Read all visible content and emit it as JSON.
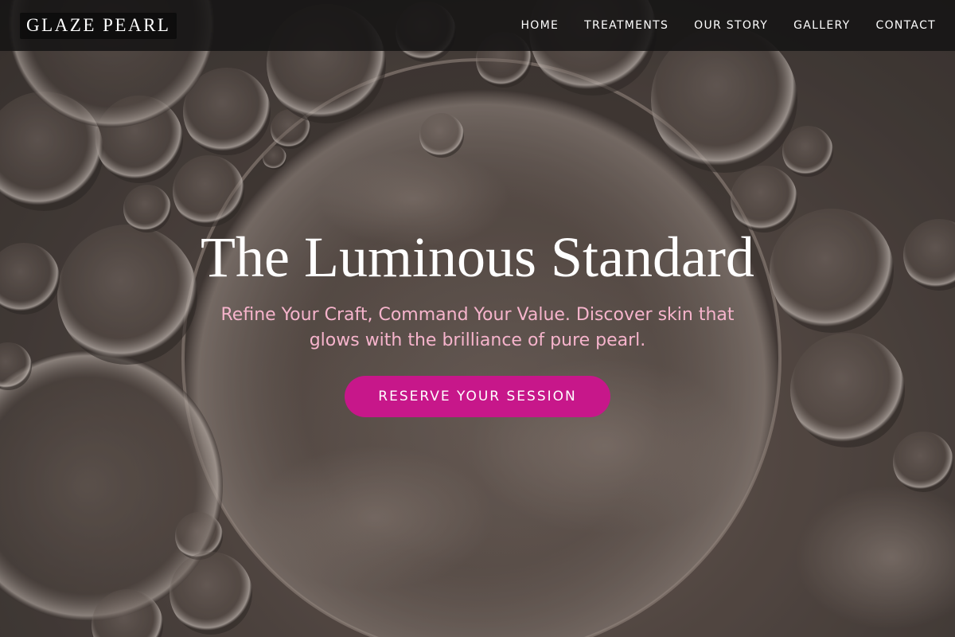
{
  "brand": {
    "logo_text": "GLAZE PEARL"
  },
  "nav": {
    "items": [
      {
        "label": "HOME"
      },
      {
        "label": "TREATMENTS"
      },
      {
        "label": "OUR STORY"
      },
      {
        "label": "GALLERY"
      },
      {
        "label": "CONTACT"
      }
    ]
  },
  "hero": {
    "title": "The Luminous Standard",
    "subtitle": "Refine Your Craft, Command Your Value. Discover skin that glows with the brilliance of pure pearl.",
    "cta_label": "RESERVE YOUR SESSION"
  },
  "colors": {
    "accent": "#c7178a",
    "subtitle": "#f6b4cc",
    "nav_bg": "#161414"
  },
  "background": {
    "image_semantic": "oil-bubbles-background"
  }
}
